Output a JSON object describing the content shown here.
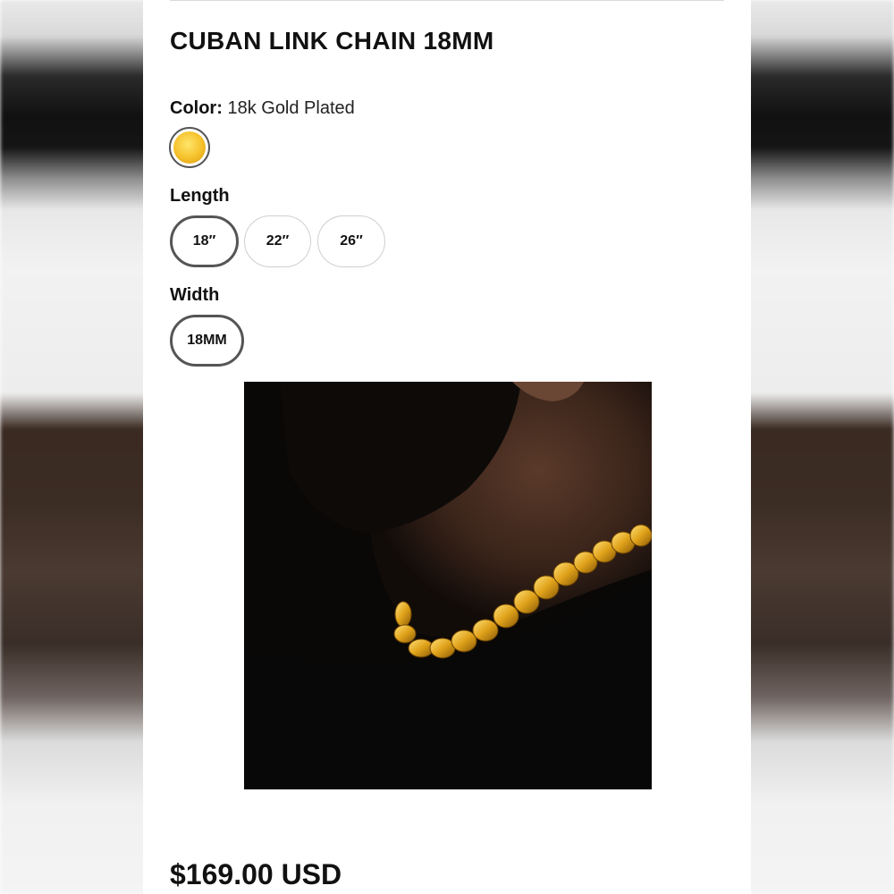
{
  "product": {
    "title": "CUBAN LINK CHAIN 18MM",
    "price": "$169.00 USD"
  },
  "options": {
    "color": {
      "label": "Color:",
      "selected_value": "18k Gold Plated",
      "swatch_color": "#f5c02a"
    },
    "length": {
      "label": "Length",
      "choices": [
        "18″",
        "22″",
        "26″"
      ],
      "selected": "18″"
    },
    "width": {
      "label": "Width",
      "choices": [
        "18MM"
      ],
      "selected": "18MM"
    }
  },
  "image": {
    "alt": "Man with beard wearing gold Cuban link chain"
  },
  "colors": {
    "accent_border": "#555555",
    "gold": "#f5c02a",
    "text": "#111111"
  }
}
